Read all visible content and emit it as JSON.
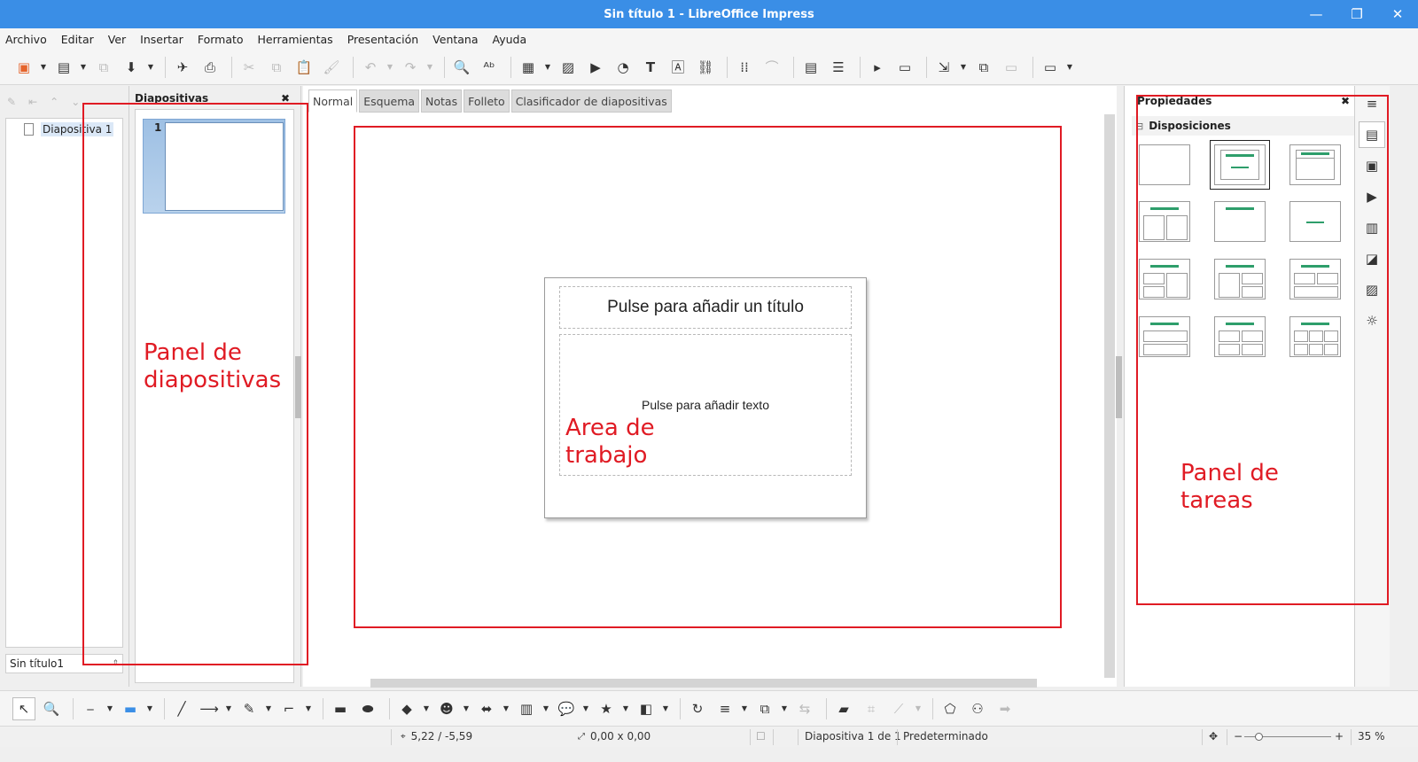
{
  "window": {
    "title": "Sin título 1 - LibreOffice Impress",
    "minimize": "—",
    "maximize": "❐",
    "close": "✕"
  },
  "menu": [
    "Archivo",
    "Editar",
    "Ver",
    "Insertar",
    "Formato",
    "Herramientas",
    "Presentación",
    "Ventana",
    "Ayuda"
  ],
  "navigator": {
    "item": "Diapositiva 1",
    "document": "Sin título1"
  },
  "slides_panel": {
    "title": "Diapositivas",
    "close": "✖",
    "thumb_number": "1"
  },
  "view_tabs": [
    "Normal",
    "Esquema",
    "Notas",
    "Folleto",
    "Clasificador de diapositivas"
  ],
  "active_tab": "Normal",
  "slide": {
    "title_placeholder": "Pulse para añadir un título",
    "body_placeholder": "Pulse para añadir texto"
  },
  "sidebar": {
    "title": "Propiedades",
    "close": "✖",
    "section": "Disposiciones",
    "collapse": "⊟"
  },
  "status": {
    "position": "5,22 / -5,59",
    "size": "0,00 x 0,00",
    "slide": "Diapositiva 1 de 1",
    "master": "Predeterminado",
    "zoom": "35 %"
  },
  "annotations": {
    "slides_panel": "Panel de diapositivas",
    "work_area": "Area de trabajo",
    "task_panel": "Panel de tareas"
  },
  "colors": {
    "titlebar": "#3a8ee6",
    "annotation": "#e01b24",
    "layout_accent": "#2e9e6b"
  }
}
